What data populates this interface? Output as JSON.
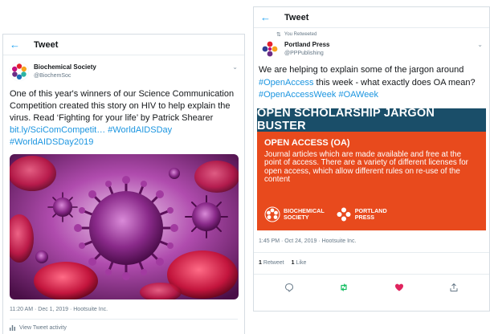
{
  "left_tweet": {
    "header_title": "Tweet",
    "author_name": "Biochemical Society",
    "author_handle": "@BiochemSoc",
    "text": "One of this year's winners of our Science Communication Competition created this story on HIV to help explain the virus. Read ‘Fighting for your life’ by Patrick Shearer",
    "links": "bit.ly/SciComCompetit… #WorldAIDSDay #WorldAIDSDay2019",
    "image": "virus-illustration",
    "timestamp": "11:20 AM · Dec 1, 2019 · Hootsuite Inc.",
    "activity_label": "View Tweet activity"
  },
  "right_tweet": {
    "header_title": "Tweet",
    "retweet_label": "You Retweeted",
    "author_name": "Portland Press",
    "author_handle": "@PPPublishing",
    "text": "We are helping to explain some of the jargon around",
    "hashtag_1": "#OpenAccess",
    "text_2": " this week - what exactly does OA mean?",
    "hashtags_2": "#OpenAccessWeek #OAWeek",
    "image": {
      "banner": "OPEN SCHOLARSHIP JARGON BUSTER",
      "heading": "OPEN ACCESS (OA)",
      "body": "Journal articles which are made available and free at the point of access. There are a variety of different licenses for open access, which allow different rules on re-use of the content",
      "logo_1": "BIOCHEMICAL\nSOCIETY",
      "logo_2": "PORTLAND\nPRESS"
    },
    "timestamp": "1:45 PM · Oct 24, 2019 · Hootsuite Inc.",
    "retweets_count": "1",
    "retweets_label": "Retweet",
    "likes_count": "1",
    "likes_label": "Like",
    "actions": [
      "reply-icon",
      "retweet-icon",
      "like-icon",
      "share-icon"
    ]
  },
  "colors": {
    "link": "#1b95e0",
    "oa_orange": "#e84a1d",
    "oa_navy": "#1a4e69",
    "retweet_green": "#17bf63",
    "like_pink": "#e0245e"
  }
}
